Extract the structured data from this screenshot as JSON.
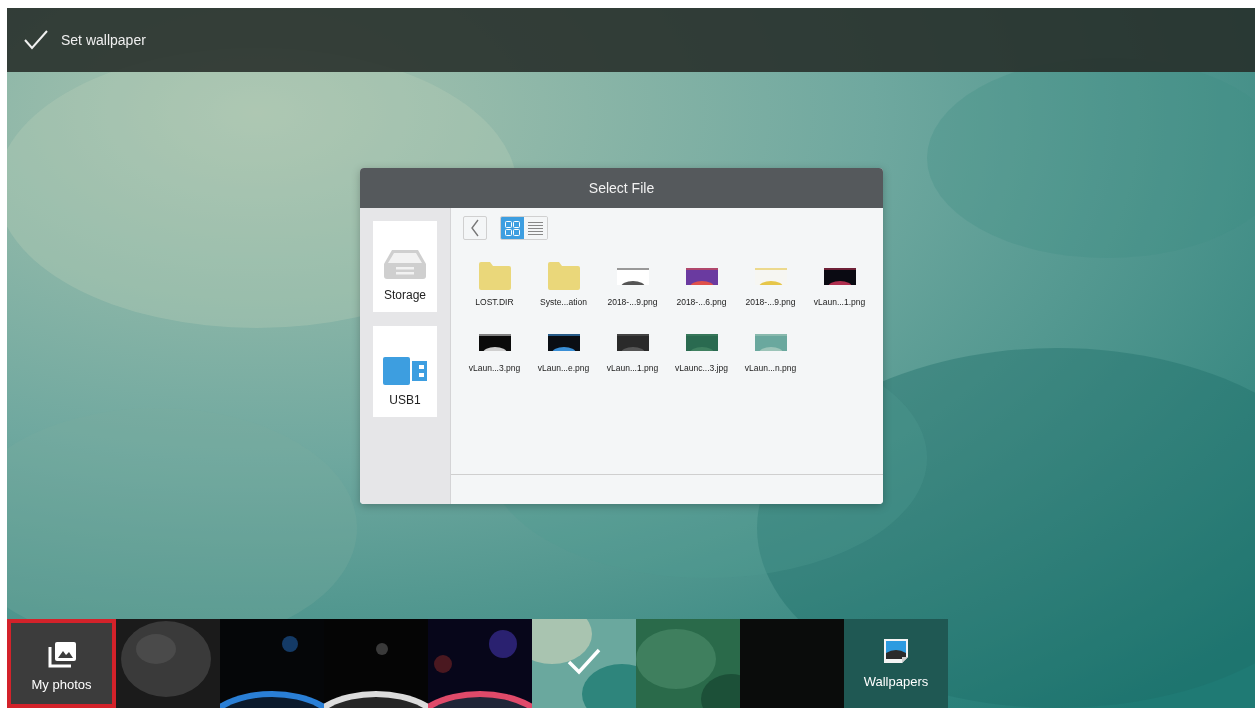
{
  "top_bar": {
    "title": "Set wallpaper"
  },
  "dialog": {
    "title": "Select File",
    "sources": [
      {
        "kind": "storage",
        "label": "Storage"
      },
      {
        "kind": "usb",
        "label": "USB1"
      }
    ],
    "view_buttons": [
      {
        "kind": "grid",
        "selected": true
      },
      {
        "kind": "list",
        "selected": false
      }
    ],
    "files": [
      {
        "kind": "folder",
        "name": "LOST.DIR"
      },
      {
        "kind": "folder",
        "name": "Syste...ation"
      },
      {
        "kind": "picture",
        "name": "2018-...9.png"
      },
      {
        "kind": "picture",
        "name": "2018-...6.png"
      },
      {
        "kind": "picture",
        "name": "2018-...9.png"
      },
      {
        "kind": "picture",
        "name": "vLaun...1.png"
      },
      {
        "kind": "picture",
        "name": "vLaun...3.png"
      },
      {
        "kind": "picture",
        "name": "vLaun...e.png"
      },
      {
        "kind": "picture",
        "name": "vLaun...1.png"
      },
      {
        "kind": "picture",
        "name": "vLaunc...3.jpg"
      },
      {
        "kind": "picture",
        "name": "vLaun...n.png"
      }
    ]
  },
  "strip": {
    "items": [
      {
        "kind": "photos",
        "label": "My photos",
        "selected": true
      },
      {
        "kind": "picture",
        "selected": false,
        "current": false
      },
      {
        "kind": "picture",
        "selected": false,
        "current": false
      },
      {
        "kind": "picture",
        "selected": false,
        "current": false
      },
      {
        "kind": "picture",
        "selected": false,
        "current": false
      },
      {
        "kind": "picture",
        "selected": false,
        "current": true
      },
      {
        "kind": "picture",
        "selected": false,
        "current": false
      },
      {
        "kind": "picture",
        "selected": false,
        "current": false
      },
      {
        "kind": "wallpapers",
        "label": "Wallpapers",
        "selected": false
      }
    ]
  }
}
